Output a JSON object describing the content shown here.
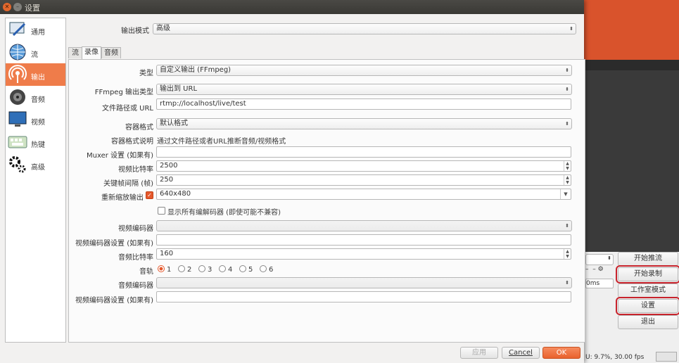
{
  "window": {
    "title": "设置"
  },
  "sidebar": {
    "items": [
      {
        "label": "通用",
        "icon": "monitor-pen-icon"
      },
      {
        "label": "流",
        "icon": "globe-icon"
      },
      {
        "label": "输出",
        "icon": "broadcast-icon",
        "active": true
      },
      {
        "label": "音频",
        "icon": "speaker-icon"
      },
      {
        "label": "视频",
        "icon": "display-icon"
      },
      {
        "label": "热键",
        "icon": "keyboard-icon"
      },
      {
        "label": "高级",
        "icon": "gears-icon"
      }
    ]
  },
  "output_mode": {
    "label": "输出模式",
    "value": "高级"
  },
  "tabs": [
    {
      "label": "流"
    },
    {
      "label": "录像",
      "active": true
    },
    {
      "label": "音频"
    }
  ],
  "form": {
    "type": {
      "label": "类型",
      "value": "自定义输出 (FFmpeg)"
    },
    "ffmpeg_output_type": {
      "label": "FFmpeg 输出类型",
      "value": "输出到 URL"
    },
    "file_path_url": {
      "label": "文件路径或 URL",
      "value": "rtmp://localhost/live/test"
    },
    "container_format": {
      "label": "容器格式",
      "value": "默认格式"
    },
    "container_desc": {
      "label": "容器格式说明",
      "value": "通过文件路径或者URL推断音频/视频格式"
    },
    "muxer_settings": {
      "label": "Muxer 设置 (如果有)",
      "value": ""
    },
    "video_bitrate": {
      "label": "视频比特率",
      "value": "2500"
    },
    "keyframe_interval": {
      "label": "关键帧间隔 (帧)",
      "value": "250"
    },
    "rescale_output": {
      "label": "重新缩放输出",
      "value": "640x480",
      "checked": true
    },
    "show_all_codecs": {
      "label": "显示所有编解码器 (即使可能不兼容)",
      "checked": false
    },
    "video_encoder": {
      "label": "视频编码器",
      "value": ""
    },
    "video_encoder_settings": {
      "label": "视频编码器设置 (如果有)",
      "value": ""
    },
    "audio_bitrate": {
      "label": "音频比特率",
      "value": "160"
    },
    "audio_track": {
      "label": "音轨",
      "options": [
        "1",
        "2",
        "3",
        "4",
        "5",
        "6"
      ],
      "selected": "1"
    },
    "audio_encoder": {
      "label": "音频编码器",
      "value": ""
    },
    "audio_encoder_settings": {
      "label": "视频编码器设置 (如果有)",
      "value": ""
    }
  },
  "buttons": {
    "apply": "应用",
    "cancel": "Cancel",
    "ok": "OK"
  },
  "obs": {
    "start_stream": "开始推流",
    "start_record": "开始录制",
    "studio_mode": "工作室模式",
    "settings": "设置",
    "exit": "退出",
    "delay_text": "0ms",
    "status": "U: 9.7%, 30.00 fps"
  }
}
